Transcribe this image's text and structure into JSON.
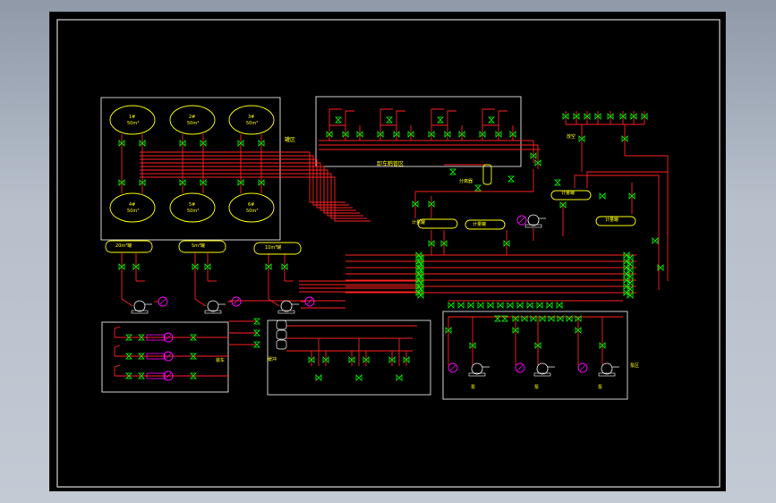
{
  "drawing": {
    "background_color": "#000000",
    "frame_color": "#ffffff",
    "pipe_color": "#ff2020",
    "valve_color": "#00ff00",
    "label_color": "#ffff00",
    "pump_color": "#ff00ff"
  },
  "labels": {
    "tank_a": "1#\n50m³",
    "tank_b": "2#\n50m³",
    "tank_c": "3#\n50m³",
    "tank_d": "4#\n50m³",
    "tank_e": "5#\n50m³",
    "tank_f": "6#\n50m³",
    "horizontal_tank_1": "20m³罐",
    "horizontal_tank_2": "5m³罐",
    "horizontal_tank_3": "10m³罐",
    "manifold_label": "卸车鹤管区",
    "small_tank_1": "计量罐",
    "small_tank_2": "计量罐",
    "small_tank_3": "计量罐",
    "small_tank_4": "计量罐",
    "pump_group_right_1": "泵",
    "pump_group_right_2": "泵",
    "pump_group_right_3": "泵",
    "annot_tankfarm": "罐区",
    "annot_loading": "装车",
    "annot_buffer": "缓冲",
    "annot_right": "泵区",
    "annot_top_right": "放空",
    "annot_separator": "分离器"
  }
}
